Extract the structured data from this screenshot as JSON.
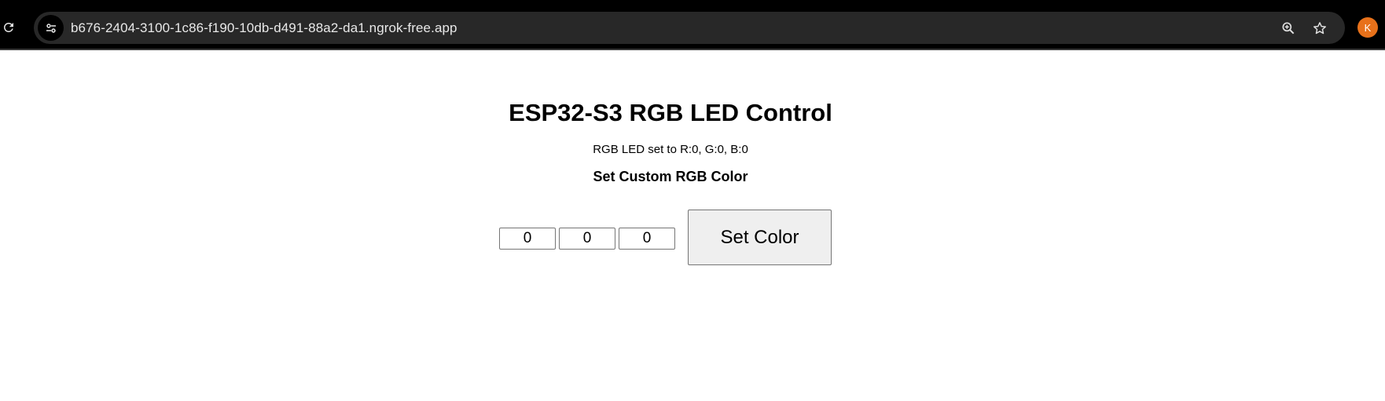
{
  "browser": {
    "url": "b676-2404-3100-1c86-f190-10db-d491-88a2-da1.ngrok-free.app",
    "profile_initial": "K",
    "profile_color": "#e8711a",
    "icons": {
      "reload": "reload-icon",
      "site_info": "tune-icon",
      "zoom": "zoom-in-icon",
      "bookmark": "star-icon"
    }
  },
  "page": {
    "title": "ESP32-S3 RGB LED Control",
    "status": "RGB LED set to R:0, G:0, B:0",
    "section_heading": "Set Custom RGB Color",
    "inputs": {
      "red": "0",
      "green": "0",
      "blue": "0"
    },
    "set_button_label": "Set Color"
  }
}
